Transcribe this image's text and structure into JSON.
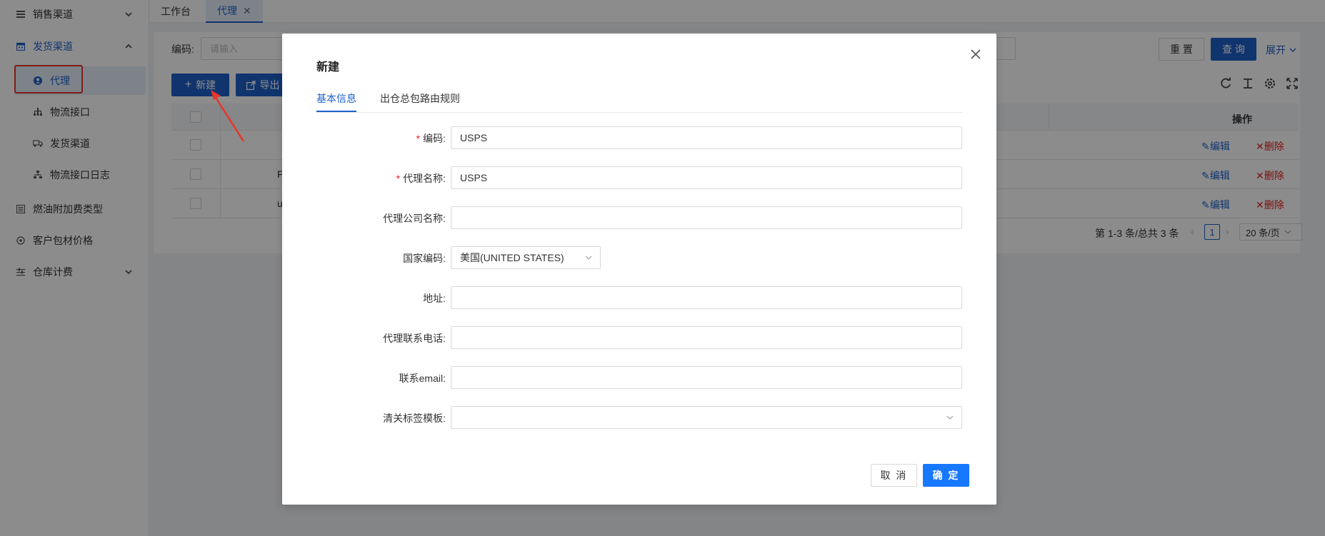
{
  "sidebar": {
    "items": [
      {
        "label": "销售渠道",
        "icon": "list-icon",
        "expanded": false
      },
      {
        "label": "发货渠道",
        "icon": "calendar-icon",
        "expanded": true,
        "children": [
          {
            "label": "代理",
            "icon": "user-circle-icon",
            "selected": true
          },
          {
            "label": "物流接口",
            "icon": "network-icon"
          },
          {
            "label": "发货渠道",
            "icon": "truck-icon"
          },
          {
            "label": "物流接口日志",
            "icon": "hierarchy-icon"
          }
        ]
      },
      {
        "label": "燃油附加费类型",
        "icon": "list-icon"
      },
      {
        "label": "客户包材价格",
        "icon": "settings-dial-icon"
      },
      {
        "label": "仓库计费",
        "icon": "sliders-icon",
        "expanded": false
      }
    ]
  },
  "tabs": [
    {
      "label": "工作台"
    },
    {
      "label": "代理",
      "active": true,
      "close": "✕"
    }
  ],
  "filter": {
    "code_label": "编码:",
    "code_placeholder": "请输入"
  },
  "actions": {
    "reset": "重 置",
    "query": "查 询",
    "expand": "展开",
    "new": "新建",
    "export": "导出"
  },
  "table": {
    "op_header": "操作",
    "rows": [
      {
        "prefix": "·",
        "edit": "编辑",
        "delete": "删除"
      },
      {
        "prefix": "F",
        "edit": "编辑",
        "delete": "删除"
      },
      {
        "prefix": "u",
        "edit": "编辑",
        "delete": "删除"
      }
    ]
  },
  "pagination": {
    "summary": "第 1-3 条/总共 3 条",
    "current_page": "1",
    "page_size": "20 条/页"
  },
  "modal": {
    "title": "新建",
    "tabs": [
      "基本信息",
      "出仓总包路由规则"
    ],
    "fields": {
      "code": {
        "label": "编码:",
        "required": "*",
        "value": "USPS"
      },
      "agent_name": {
        "label": "代理名称:",
        "required": "*",
        "value": "USPS"
      },
      "company_name": {
        "label": "代理公司名称:",
        "value": ""
      },
      "country_code": {
        "label": "国家编码:",
        "value": "美国(UNITED STATES)"
      },
      "address": {
        "label": "地址:",
        "value": ""
      },
      "phone": {
        "label": "代理联系电话:",
        "value": ""
      },
      "email": {
        "label": "联系email:",
        "value": ""
      },
      "customs_template": {
        "label": "清关标签模板:",
        "value": ""
      }
    },
    "cancel": "取 消",
    "ok": "确 定"
  },
  "colors": {
    "primary": "#1e62c8",
    "confirm": "#1677ff",
    "danger": "#e02020",
    "annotation": "#e8352a"
  }
}
